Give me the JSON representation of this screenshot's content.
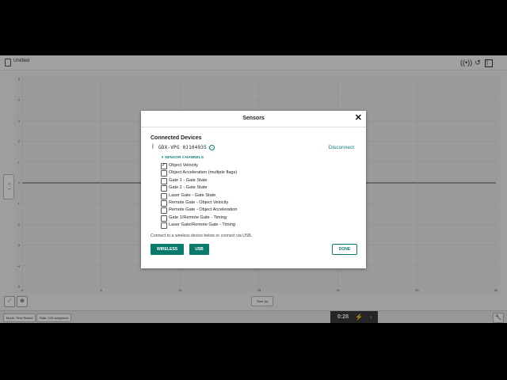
{
  "app": {
    "doc_title": "Untitled"
  },
  "graph": {
    "y_ticks": [
      "5",
      "4",
      "3",
      "2",
      "1",
      "0",
      "-1",
      "-2",
      "-3",
      "-4",
      "-5"
    ],
    "x_ticks": [
      "0",
      "5",
      "10",
      "15",
      "20",
      "25",
      "30"
    ],
    "y_label": "[ ... ]",
    "x_label": "Time (s)"
  },
  "bottombar": {
    "mode": "Mode: Time Based",
    "rate": "Rate: 100 samples/s",
    "timer": "0:28"
  },
  "dialog": {
    "title": "Sensors",
    "close": "✕",
    "section_title": "Connected Devices",
    "device_name": "GDX-VPG 0J104935",
    "disconnect": "Disconnect",
    "channels_header": "▾ SENSOR CHANNELS",
    "channels": [
      {
        "label": "Object Velocity",
        "checked": true
      },
      {
        "label": "Object Acceleration (multiple flags)",
        "checked": false
      },
      {
        "label": "Gate 1 - Gate State",
        "checked": false
      },
      {
        "label": "Gate 2 - Gate State",
        "checked": false
      },
      {
        "label": "Laser Gate - Gate State",
        "checked": false
      },
      {
        "label": "Remote Gate - Object Velocity",
        "checked": false
      },
      {
        "label": "Remote Gate - Object Acceleration",
        "checked": false
      },
      {
        "label": "Gate 1/Remote Gate - Timing",
        "checked": false
      },
      {
        "label": "Laser Gate/Remote Gate - Timing",
        "checked": false
      }
    ],
    "note": "Connect to a wireless device below or connect via USB.",
    "wireless": "WIRELESS",
    "usb": "USB",
    "done": "DONE"
  },
  "colors": {
    "accent": "#0a7a6c",
    "overlay": "#000000"
  }
}
